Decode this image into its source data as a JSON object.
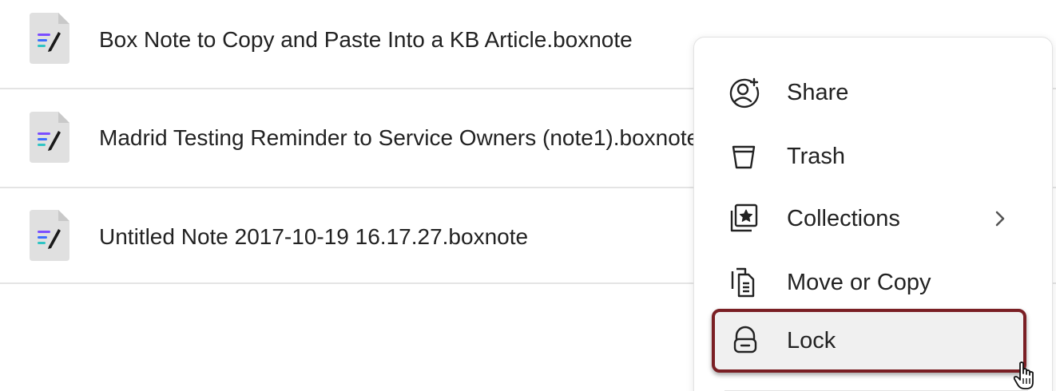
{
  "files": [
    {
      "name": "Box Note to Copy and Paste Into a KB Article.boxnote",
      "icon": "boxnote-icon"
    },
    {
      "name": "Madrid Testing Reminder to Service Owners (note1).boxnote",
      "icon": "boxnote-icon"
    },
    {
      "name": "Untitled Note 2017-10-19 16.17.27.boxnote",
      "icon": "boxnote-icon"
    }
  ],
  "context_menu": {
    "items": [
      {
        "label": "Share",
        "icon": "share-user-icon"
      },
      {
        "label": "Trash",
        "icon": "trash-icon"
      },
      {
        "label": "Collections",
        "icon": "collections-icon",
        "submenu_icon": "chevron-right-icon"
      },
      {
        "label": "Move or Copy",
        "icon": "move-copy-icon"
      },
      {
        "label": "Lock",
        "icon": "lock-icon",
        "highlighted": true
      }
    ]
  },
  "colors": {
    "highlight_border": "#7a1f24",
    "highlight_bg": "#f0f0f0",
    "text": "#222222",
    "divider": "#e4e4e4"
  },
  "cursor": "hand-pointer-icon"
}
